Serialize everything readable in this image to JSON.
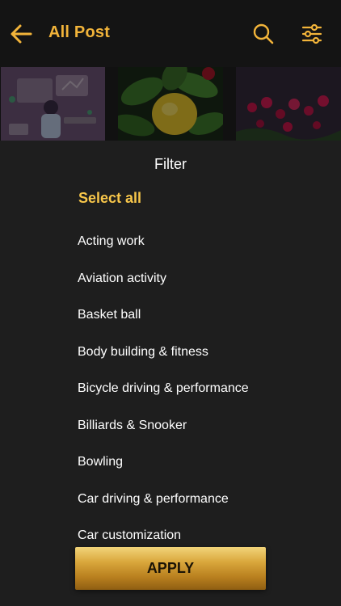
{
  "header": {
    "title": "All Post",
    "back_icon": "arrow-left-icon",
    "search_icon": "search-icon",
    "filter_icon": "sliders-icon"
  },
  "thumbnails": [
    {
      "subject": "illustration-person-at-desk"
    },
    {
      "subject": "leaves-and-fruit"
    },
    {
      "subject": "red-flowers"
    }
  ],
  "filter": {
    "title": "Filter",
    "select_all": "Select all",
    "items": [
      "Acting work",
      "Aviation activity",
      "Basket ball",
      "Body building & fitness",
      "Bicycle driving & performance",
      "Billiards & Snooker",
      "Bowling",
      "Car driving & performance",
      "Car customization"
    ],
    "apply_label": "APPLY"
  },
  "colors": {
    "accent": "#f2b43a",
    "background": "#1e1e1e",
    "header_background": "#141414",
    "text": "#ffffff"
  }
}
